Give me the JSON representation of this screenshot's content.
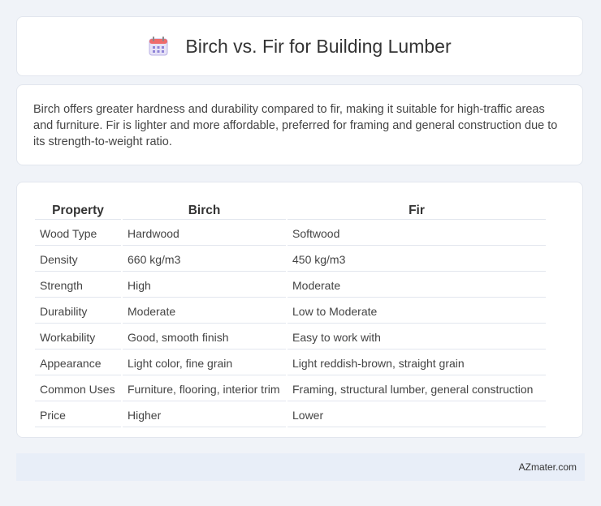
{
  "header": {
    "title": "Birch vs. Fir for Building Lumber",
    "icon": "calendar-icon"
  },
  "summary": {
    "text": "Birch offers greater hardness and durability compared to fir, making it suitable for high-traffic areas and furniture. Fir is lighter and more affordable, preferred for framing and general construction due to its strength-to-weight ratio."
  },
  "table": {
    "headers": [
      "Property",
      "Birch",
      "Fir"
    ],
    "rows": [
      [
        "Wood Type",
        "Hardwood",
        "Softwood"
      ],
      [
        "Density",
        "660 kg/m3",
        "450 kg/m3"
      ],
      [
        "Strength",
        "High",
        "Moderate"
      ],
      [
        "Durability",
        "Moderate",
        "Low to Moderate"
      ],
      [
        "Workability",
        "Good, smooth finish",
        "Easy to work with"
      ],
      [
        "Appearance",
        "Light color, fine grain",
        "Light reddish-brown, straight grain"
      ],
      [
        "Common Uses",
        "Furniture, flooring, interior trim",
        "Framing, structural lumber, general construction"
      ],
      [
        "Price",
        "Higher",
        "Lower"
      ]
    ]
  },
  "footer": {
    "brand": "AZmater.com"
  }
}
